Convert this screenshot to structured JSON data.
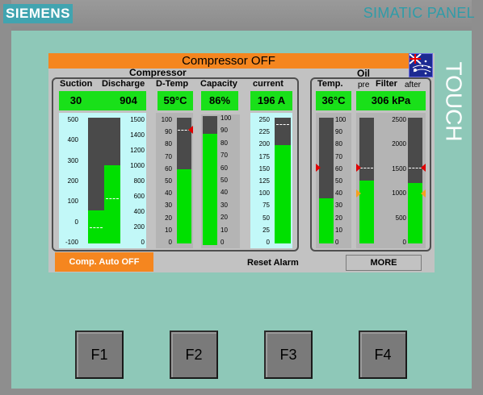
{
  "device": {
    "brand": "SIEMENS",
    "panel_name": "SIMATIC PANEL",
    "touch_label": "TOUCH"
  },
  "screen": {
    "title": "Compressor OFF",
    "compressor_label": "Compressor",
    "oil_label": "Oil",
    "headers": {
      "suction": "Suction",
      "discharge": "Discharge",
      "dtemp": "D-Temp",
      "capacity": "Capacity",
      "current": "current",
      "temp": "Temp.",
      "pre": "pre",
      "filter": "Filter",
      "after": "after"
    },
    "readouts": {
      "suction": "30",
      "discharge": "904",
      "dtemp": "59°C",
      "capacity": "86%",
      "current": "196 A",
      "oil_temp": "36°C",
      "oil_filter": "306 kPa"
    },
    "scales": {
      "suction": [
        "500",
        "400",
        "300",
        "200",
        "100",
        "0",
        "-100"
      ],
      "discharge": [
        "1500",
        "1400",
        "1200",
        "1000",
        "800",
        "600",
        "400",
        "200",
        "0"
      ],
      "dtemp": [
        "100",
        "90",
        "80",
        "70",
        "60",
        "50",
        "40",
        "30",
        "20",
        "10",
        "0"
      ],
      "capacity": [
        "100",
        "90",
        "80",
        "70",
        "60",
        "50",
        "40",
        "30",
        "20",
        "10",
        "0"
      ],
      "current": [
        "250",
        "225",
        "200",
        "175",
        "150",
        "125",
        "100",
        "75",
        "50",
        "25",
        "0"
      ],
      "oil_temp": [
        "100",
        "90",
        "80",
        "70",
        "60",
        "50",
        "40",
        "30",
        "20",
        "10",
        "0"
      ],
      "oil_filter": [
        "2500",
        "2000",
        "1500",
        "1000",
        "500",
        "0"
      ]
    },
    "levels": {
      "suction": 0.26,
      "discharge": 0.62,
      "dtemp": 0.59,
      "capacity": 0.86,
      "current": 0.784,
      "oil_temp": 0.36,
      "oil_pre": 0.5,
      "oil_after": 0.48
    },
    "buttons": {
      "auto": "Comp. Auto OFF",
      "reset": "Reset Alarm",
      "more": "MORE"
    }
  },
  "function_keys": [
    "F1",
    "F2",
    "F3",
    "F4"
  ]
}
